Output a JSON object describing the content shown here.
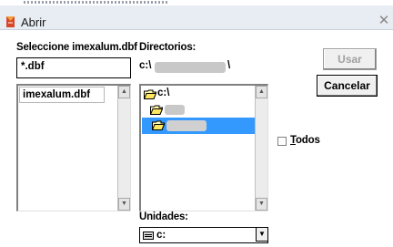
{
  "window": {
    "title": "Abrir",
    "close_glyph": "✕"
  },
  "file_section": {
    "label": "Seleccione imexalum.dbf",
    "filter_value": "*.dbf",
    "files": [
      "imexalum.dbf"
    ]
  },
  "dir_section": {
    "label": "Directorios:",
    "path_prefix": "c:\\",
    "path_suffix": "\\",
    "tree": [
      {
        "label": "c:\\",
        "icon": "open-folder-icon"
      },
      {
        "label": "",
        "icon": "open-folder-icon"
      },
      {
        "label": "",
        "icon": "open-folder-icon",
        "selected": true
      }
    ]
  },
  "buttons": {
    "use_label": "Usar",
    "cancel_label": "Cancelar"
  },
  "all_checkbox": {
    "label_first": "T",
    "label_rest": "odos",
    "checked": false
  },
  "drives": {
    "label": "Unidades:",
    "value": "c:"
  },
  "colors": {
    "selection": "#3399ff",
    "titlebar": "#e8edf4"
  }
}
